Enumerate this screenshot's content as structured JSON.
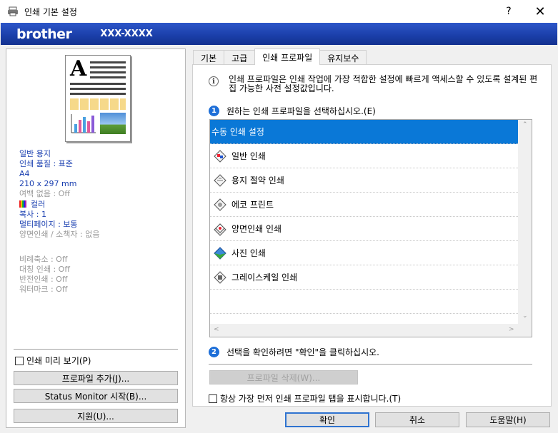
{
  "window": {
    "title": "인쇄 기본 설정",
    "help": "?",
    "close": "✕"
  },
  "brand": {
    "logo": "brother",
    "model": "XXX-XXXX"
  },
  "summary": {
    "paper_type": "일반 용지",
    "print_quality": "인쇄 품질 : 표준",
    "paper_size": "A4",
    "dimensions": "210 x 297 mm",
    "borderless": "여백 없음 : Off",
    "color": "컬러",
    "copies": "복사 : 1",
    "multipage": "멀티페이지 : 보통",
    "duplex": "양면인쇄 / 소책자 : 없음",
    "scaling": "비례축소 : Off",
    "mirror": "대칭 인쇄 : Off",
    "reverse": "반전인쇄 : Off",
    "watermark": "워터마크 : Off"
  },
  "left": {
    "preview_checkbox": "인쇄 미리 보기(P)",
    "add_profile": "프로파일 추가(J)...",
    "status_monitor": "Status Monitor 시작(B)...",
    "support": "지원(U)..."
  },
  "tabs": [
    {
      "label": "기본"
    },
    {
      "label": "고급"
    },
    {
      "label": "인쇄 프로파일"
    },
    {
      "label": "유지보수"
    }
  ],
  "profile": {
    "description": "인쇄 프로파일은 인쇄 작업에 가장 적합한 설정에 빠르게 액세스할 수 있도록 설계된 편집 가능한 사전 설정값입니다.",
    "step1_num": "1",
    "step1": "원하는 인쇄 프로파일을 선택하십시오.(E)",
    "items": [
      {
        "label": "수동 인쇄 설정",
        "icon": ""
      },
      {
        "label": "일반 인쇄",
        "icon": "general-print-icon"
      },
      {
        "label": "용지 절약 인쇄",
        "icon": "paper-save-icon"
      },
      {
        "label": "에코 프린트",
        "icon": "eco-print-icon"
      },
      {
        "label": "양면인쇄 인쇄",
        "icon": "duplex-print-icon"
      },
      {
        "label": "사진 인쇄",
        "icon": "photo-print-icon"
      },
      {
        "label": "그레이스케일 인쇄",
        "icon": "grayscale-print-icon"
      }
    ],
    "step2_num": "2",
    "step2": "선택을 확인하려면 \"확인\"을 클릭하십시오.",
    "delete_profile": "프로파일 삭제(W)...",
    "always_show": "항상 가장 먼저 인쇄 프로파일 탭을 표시합니다.(T)"
  },
  "footer": {
    "ok": "확인",
    "cancel": "취소",
    "help": "도움말(H)"
  },
  "colors": {
    "brand_blue": "#1a3ea8",
    "selection": "#0a78d7",
    "step_badge": "#1e6fd8",
    "summary_text": "#1a3fb0"
  }
}
